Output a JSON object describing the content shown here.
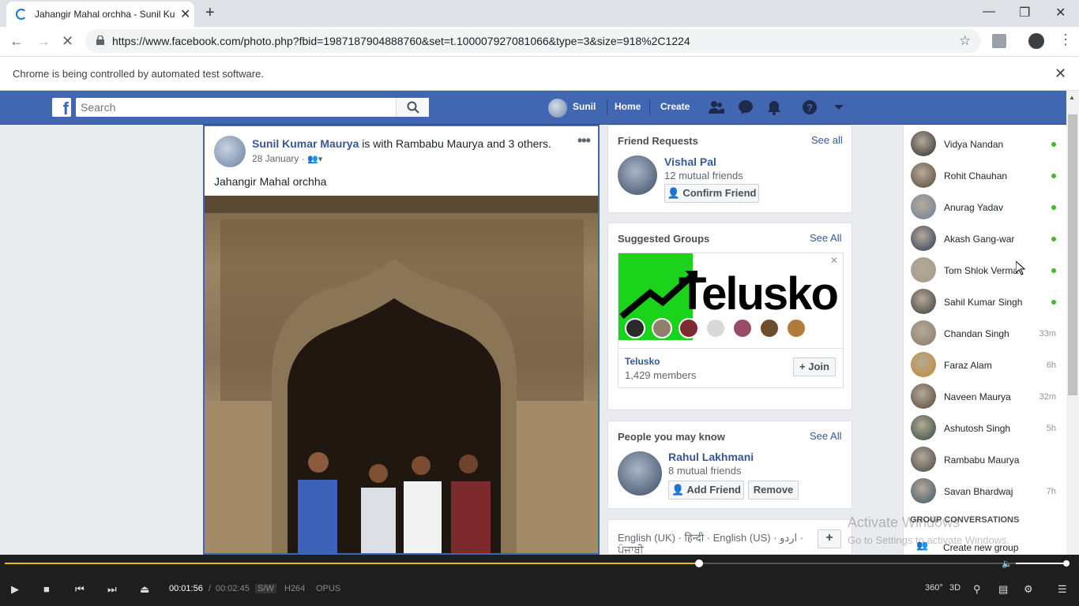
{
  "browser": {
    "tab_title": "Jahangir Mahal orchha - Sunil Ku",
    "url": "https://www.facebook.com/photo.php?fbid=1987187904888760&set=t.100007927081066&type=3&size=918%2C1224",
    "automation_notice": "Chrome is being controlled by automated test software."
  },
  "fb_header": {
    "search_placeholder": "Search",
    "profile_name": "Sunil",
    "home": "Home",
    "create": "Create"
  },
  "post": {
    "author": "Sunil Kumar Maurya",
    "with_text": " is with Rambabu Maurya and 3 others.",
    "date": "28 January ·",
    "caption": "Jahangir Mahal orchha"
  },
  "friend_requests": {
    "title": "Friend Requests",
    "see_all": "See all",
    "name": "Vishal Pal",
    "mutual": "12 mutual friends",
    "confirm": "Confirm Friend"
  },
  "suggested_groups": {
    "title": "Suggested Groups",
    "see_all": "See All",
    "banner_text": "Telusko",
    "group_name": "Telusko",
    "members": "1,429 members",
    "join": "+ Join"
  },
  "people": {
    "title": "People you may know",
    "see_all": "See All",
    "name": "Rahul Lakhmani",
    "mutual": "8 mutual friends",
    "add": "Add Friend",
    "remove": "Remove"
  },
  "languages": {
    "line1": "English (UK) · हिन्दी · English (US) · اردو ·",
    "line2": "ਪੰਜਾਬੀ"
  },
  "chat": {
    "contacts": [
      {
        "name": "Vidya Nandan",
        "status": "online",
        "ago": ""
      },
      {
        "name": "Rohit Chauhan",
        "status": "online",
        "ago": ""
      },
      {
        "name": "Anurag Yadav",
        "status": "online",
        "ago": ""
      },
      {
        "name": "Akash Gang-war",
        "status": "online",
        "ago": ""
      },
      {
        "name": "Tom Shlok Verma",
        "status": "online",
        "ago": ""
      },
      {
        "name": "Sahil Kumar Singh",
        "status": "online",
        "ago": ""
      },
      {
        "name": "Chandan Singh",
        "status": "away",
        "ago": "33m"
      },
      {
        "name": "Faraz Alam",
        "status": "away",
        "ago": "6h"
      },
      {
        "name": "Naveen Maurya",
        "status": "away",
        "ago": "32m"
      },
      {
        "name": "Ashutosh Singh",
        "status": "away",
        "ago": "5h"
      },
      {
        "name": "Rambabu Maurya",
        "status": "away",
        "ago": ""
      },
      {
        "name": "Savan Bhardwaj",
        "status": "away",
        "ago": "7h"
      }
    ],
    "group_heading": "GROUP CONVERSATIONS",
    "create_group": "Create new group"
  },
  "watermark": {
    "line1": "Activate Windows",
    "line2": "Go to Settings to activate Windows."
  },
  "player": {
    "elapsed": "00:01:56",
    "separator": "/",
    "total": "00:02:45",
    "tags": [
      "S/W",
      "H264",
      "OPUS"
    ],
    "progress": 0.655,
    "volume": 1.0
  }
}
